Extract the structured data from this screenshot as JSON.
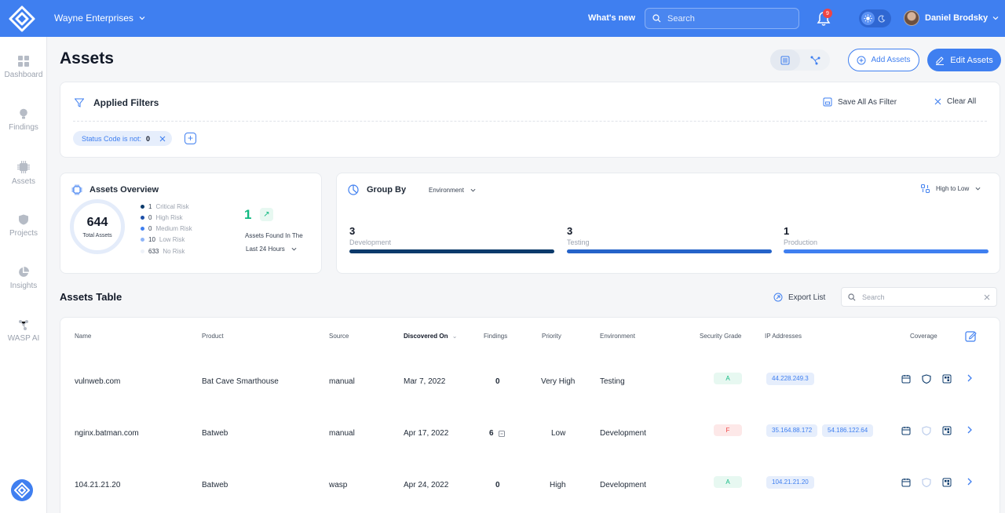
{
  "topbar": {
    "org": "Wayne Enterprises",
    "whats_new": "What's new",
    "search_placeholder": "Search",
    "notification_count": "9",
    "user": "Daniel Brodsky"
  },
  "sidebar": {
    "items": [
      {
        "label": "Dashboard",
        "icon": "grid-icon"
      },
      {
        "label": "Findings",
        "icon": "bulb-icon"
      },
      {
        "label": "Assets",
        "icon": "chip-icon"
      },
      {
        "label": "Projects",
        "icon": "shield-icon"
      },
      {
        "label": "Insights",
        "icon": "pie-icon"
      },
      {
        "label": "WASP AI",
        "icon": "network-icon"
      }
    ]
  },
  "page": {
    "title": "Assets",
    "add_assets": "Add Assets",
    "edit_assets": "Edit Assets"
  },
  "filters": {
    "title": "Applied Filters",
    "save_all": "Save All As Filter",
    "clear_all": "Clear All",
    "chip_label": "Status Code is not:",
    "chip_value": "0"
  },
  "overview": {
    "title": "Assets Overview",
    "total": "644",
    "total_label": "Total Assets",
    "risks": [
      {
        "count": "1",
        "label": "Critical Risk",
        "color": "#0b3a6b"
      },
      {
        "count": "0",
        "label": "High Risk",
        "color": "#1d4fa8"
      },
      {
        "count": "0",
        "label": "Medium Risk",
        "color": "#3f7ff0"
      },
      {
        "count": "10",
        "label": "Low Risk",
        "color": "#8fb5f7"
      },
      {
        "count": "633",
        "label": "No Risk",
        "color": "#eef2f8"
      }
    ],
    "found_count": "1",
    "found_label": "Assets Found In The",
    "found_period": "Last 24 Hours"
  },
  "groupby": {
    "title": "Group By",
    "selected": "Environment",
    "sort": "High to Low",
    "groups": [
      {
        "count": "3",
        "label": "Development",
        "color": "#0b3a6b"
      },
      {
        "count": "3",
        "label": "Testing",
        "color": "#2563c9"
      },
      {
        "count": "1",
        "label": "Production",
        "color": "#3f7ff0"
      }
    ]
  },
  "table": {
    "title": "Assets Table",
    "export": "Export List",
    "search_placeholder": "Search",
    "headers": {
      "name": "Name",
      "product": "Product",
      "source": "Source",
      "discovered": "Discovered On",
      "findings": "Findings",
      "priority": "Priority",
      "environment": "Environment",
      "grade": "Security Grade",
      "ip": "IP Addresses",
      "coverage": "Coverage"
    },
    "rows": [
      {
        "name": "vulnweb.com",
        "product": "Bat Cave Smarthouse",
        "source": "manual",
        "discovered": "Mar 7, 2022",
        "findings": "0",
        "priority": "Very High",
        "environment": "Testing",
        "grade": "A",
        "ip1": "44.228.249.3",
        "ip2": ""
      },
      {
        "name": "nginx.batman.com",
        "product": "Batweb",
        "source": "manual",
        "discovered": "Apr 17, 2022",
        "findings": "6",
        "priority": "Low",
        "environment": "Development",
        "grade": "F",
        "ip1": "35.164.88.172",
        "ip2": "54.186.122.64"
      },
      {
        "name": "104.21.21.20",
        "product": "Batweb",
        "source": "wasp",
        "discovered": "Apr 24, 2022",
        "findings": "0",
        "priority": "High",
        "environment": "Development",
        "grade": "A",
        "ip1": "104.21.21.20",
        "ip2": ""
      }
    ]
  },
  "colors": {
    "accent": "#3f7ff0",
    "grade_a": "#10b981",
    "grade_f": "#ef4444"
  }
}
